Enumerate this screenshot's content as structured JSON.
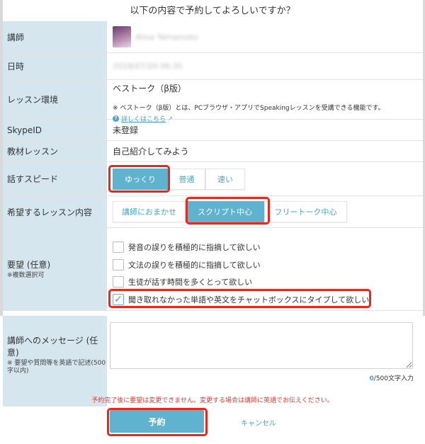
{
  "dialog": {
    "heading": "以下の内容で予約してよろしいですか？"
  },
  "rows": {
    "tutor": {
      "label": "講師",
      "name": "Ahsa Yamamoto"
    },
    "datetime": {
      "label": "日時",
      "value": "2018/07/20 06:30"
    },
    "environment": {
      "label": "レッスン環境",
      "title": "ベストーク（β版）",
      "note": "※ ベストーク（β版）とは、PCブラウザ・アプリでSpeakingレッスンを受講できる機能です。",
      "link": "詳しくはこちら"
    },
    "skype": {
      "label": "SkypeID",
      "value": "未登録"
    },
    "material": {
      "label": "教材レッスン",
      "value": "自己紹介してみよう"
    },
    "speed": {
      "label": "話すスピード",
      "options": [
        "ゆっくり",
        "普通",
        "速い"
      ],
      "selected": "ゆっくり"
    },
    "content": {
      "label": "希望するレッスン内容",
      "options": [
        "講師におまかせ",
        "スクリプト中心",
        "フリートーク中心"
      ],
      "selected": "スクリプト中心"
    },
    "requests": {
      "label": "要望 (任意)",
      "sublabel": "※複数選択可",
      "items": [
        {
          "text": "発音の誤りを積極的に指摘して欲しい",
          "checked": false
        },
        {
          "text": "文法の誤りを積極的に指摘して欲しい",
          "checked": false
        },
        {
          "text": "生徒が話す時間を多くとって欲しい",
          "checked": false
        },
        {
          "text": "聞き取れなかった単語や英文をチャットボックスにタイプして欲しい",
          "checked": true
        }
      ]
    },
    "message": {
      "label": "講師へのメッセージ (任意)",
      "sublabel": "※ 要望や質問等を英語で記述(500字以内)",
      "value": "",
      "count_current": "0",
      "count_suffix": "/500文字入力"
    }
  },
  "footer": {
    "warning": "予約完了後に要望は変更できません。変更する場合は講師に英語でお伝えください。",
    "reserve_label": "予約",
    "cancel_label": "キャンセル"
  },
  "colors": {
    "accent": "#5fb3cf",
    "label_bg": "#d5e6ef",
    "highlight": "#e8281b",
    "warning": "#e0392c"
  }
}
